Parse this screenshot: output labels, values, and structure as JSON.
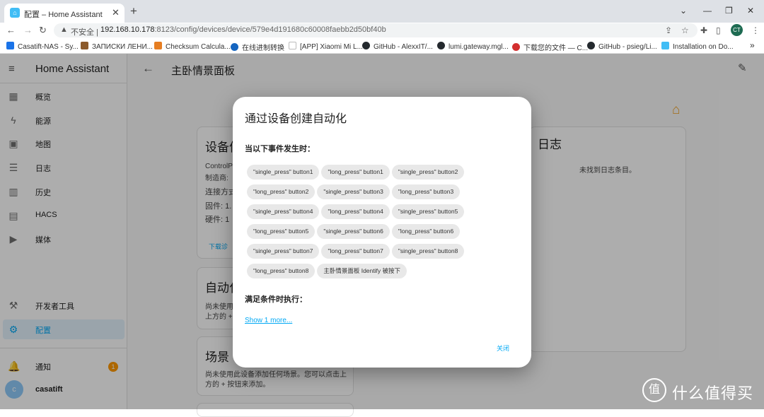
{
  "browser": {
    "tab_title": "配置 – Home Assistant",
    "tab_close": "✕",
    "new_tab": "+",
    "window_controls": [
      "⌄",
      "—",
      "❐",
      "✕"
    ],
    "nav": {
      "back": "←",
      "forward": "→",
      "reload": "↻"
    },
    "url_warning_icon": "▲",
    "url_insecure": "不安全 |",
    "url_host": "192.168.10.178",
    "url_path": ":8123/config/devices/device/579e4d191680c60008faebb2d50bf40b",
    "toolbar_icons": [
      "share-icon",
      "star-icon",
      "extension-icon",
      "sidepanel-icon",
      "menu-icon"
    ],
    "profile_initials": "CT",
    "bookmarks": [
      {
        "label": "Casatift-NAS - Sy...",
        "color": "#1a73e8"
      },
      {
        "label": "ЗАПИСКИ ЛЕНИ...",
        "color": "#8b5a2b"
      },
      {
        "label": "Checksum Calcula...",
        "color": "#e67e22"
      },
      {
        "label": "在线进制转换",
        "color": "#1565c0"
      },
      {
        "label": "[APP] Xiaomi Mi L...",
        "color": "#bbbbbb"
      },
      {
        "label": "GitHub - AlexxIT/...",
        "color": "#24292e"
      },
      {
        "label": "lumi.gateway.mgl...",
        "color": "#24292e"
      },
      {
        "label": "下载您的文件 — C...",
        "color": "#d32f2f"
      },
      {
        "label": "GitHub - psieg/Li...",
        "color": "#24292e"
      },
      {
        "label": "Installation on Do...",
        "color": "#41bdf5"
      }
    ],
    "bookmark_more": "»"
  },
  "sidebar": {
    "title": "Home Assistant",
    "menu_icon": "≡",
    "items": [
      {
        "label": "概览",
        "icon": "▦"
      },
      {
        "label": "能源",
        "icon": "ϟ"
      },
      {
        "label": "地图",
        "icon": "▣"
      },
      {
        "label": "日志",
        "icon": "☰"
      },
      {
        "label": "历史",
        "icon": "▥"
      },
      {
        "label": "HACS",
        "icon": "▤"
      },
      {
        "label": "媒体",
        "icon": "▶"
      }
    ],
    "dev_tools": {
      "label": "开发者工具",
      "icon": "⚒"
    },
    "config": {
      "label": "配置",
      "icon": "⚙"
    },
    "notifications": {
      "label": "通知",
      "icon": "🔔",
      "count": "1"
    },
    "user": {
      "initial": "c",
      "name": "casatift"
    }
  },
  "main": {
    "back_icon": "←",
    "title": "主卧情景面板",
    "edit_icon": "✎",
    "home_icon": "⌂",
    "device_card": {
      "title": "设备信",
      "line1": "ControlP",
      "line2": "制造商:",
      "line3": "连接方式",
      "line4": "固件: 1.",
      "line5": "硬件: 1",
      "link": "下载诊"
    },
    "automation_card": {
      "title": "自动化",
      "line1": "尚未使用",
      "line2": "上方的 +"
    },
    "scene_card": {
      "title": "场景",
      "line1": "尚未使用此设备添加任何场景。您可以点击上",
      "line2": "方的 + 按钮来添加。"
    },
    "logbook_card": {
      "title": "日志",
      "empty": "未找到日志条目。"
    }
  },
  "dialog": {
    "title": "通过设备创建自动化",
    "trigger_label": "当以下事件发生时：",
    "triggers": [
      "\"single_press\" button1",
      "\"long_press\" button1",
      "\"single_press\" button2",
      "\"long_press\" button2",
      "\"single_press\" button3",
      "\"long_press\" button3",
      "\"single_press\" button4",
      "\"long_press\" button4",
      "\"single_press\" button5",
      "\"long_press\" button5",
      "\"single_press\" button6",
      "\"long_press\" button6",
      "\"single_press\" button7",
      "\"long_press\" button7",
      "\"single_press\" button8",
      "\"long_press\" button8",
      "主卧情景面板 Identify 被按下"
    ],
    "action_label": "满足条件时执行：",
    "show_more": "Show 1 more...",
    "close": "关闭"
  },
  "watermark": {
    "icon": "值",
    "text": "什么值得买"
  }
}
